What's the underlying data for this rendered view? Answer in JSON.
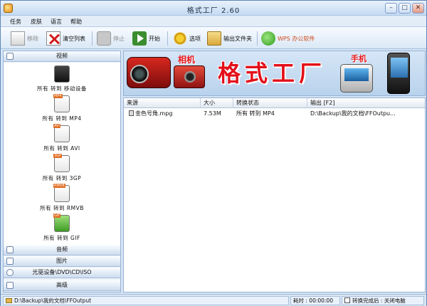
{
  "window": {
    "title": "格式工厂 2.60"
  },
  "menu": [
    "任务",
    "皮肤",
    "语言",
    "帮助"
  ],
  "toolbar": {
    "remove": "移除",
    "clear": "清空列表",
    "stop": "停止",
    "start": "开始",
    "options": "选项",
    "output_folder": "输出文件夹",
    "wps": "WPS 办公软件"
  },
  "sidebar": {
    "categories": [
      "视频",
      "音频",
      "图片",
      "光驱设备\\DVD\\CD\\ISO",
      "高级"
    ],
    "video_conversions": [
      {
        "tag": "",
        "label": "所有 转到 移动设备"
      },
      {
        "tag": "MP4",
        "label": "所有 转到 MP4"
      },
      {
        "tag": "AVI",
        "label": "所有 转到 AVI"
      },
      {
        "tag": "3GP",
        "label": "所有 转到 3GP"
      },
      {
        "tag": "RMVB",
        "label": "所有 转到 RMVB"
      },
      {
        "tag": "GIF",
        "label": "所有 转到 GIF"
      }
    ]
  },
  "banner": {
    "brand": "格式工厂",
    "camera_label": "相机",
    "phone_label": "手机"
  },
  "list": {
    "columns": [
      "来源",
      "大小",
      "转换状态",
      "输出 [F2]"
    ],
    "rows": [
      {
        "source": "金色号角.mpg",
        "size": "7.53M",
        "status": "所有 转到 MP4",
        "output": "D:\\Backup\\我的文档\\FFOutpu..."
      }
    ]
  },
  "status": {
    "output_path": "D:\\Backup\\我的文档\\FFOutput",
    "elapsed": "耗时 : 00:00:00",
    "after_done": "转换完成后 : 关闭电脑"
  },
  "colors": {
    "brand_red": "#e3101a",
    "frame_blue": "#97b1d4"
  },
  "icons": [
    "app-icon",
    "remove-icon",
    "clear-list-icon",
    "stop-icon",
    "start-icon",
    "options-icon",
    "output-folder-icon",
    "wps-icon"
  ]
}
